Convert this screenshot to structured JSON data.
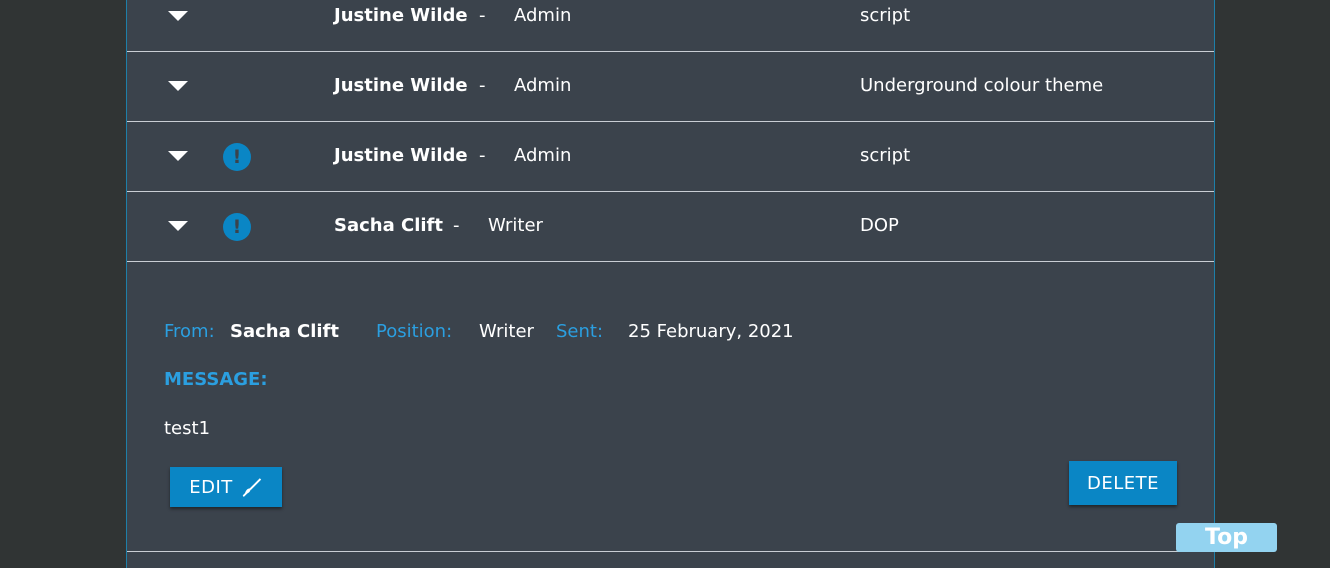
{
  "messages": [
    {
      "name": "Justine Wilde",
      "separator": "-",
      "role": "Admin",
      "subject": "script",
      "alert": false,
      "alert_glyph": "!"
    },
    {
      "name": "Justine Wilde",
      "separator": "-",
      "role": "Admin",
      "subject": "Underground colour theme",
      "alert": false,
      "alert_glyph": "!"
    },
    {
      "name": "Justine Wilde",
      "separator": "-",
      "role": "Admin",
      "subject": "script",
      "alert": true,
      "alert_glyph": "!"
    },
    {
      "name": "Sacha Clift",
      "separator": "-",
      "role": "Writer",
      "subject": "DOP",
      "alert": true,
      "alert_glyph": "!"
    }
  ],
  "detail": {
    "from_label": "From:",
    "from_value": "Sacha Clift",
    "position_label": "Position:",
    "position_value": "Writer",
    "sent_label": "Sent:",
    "sent_value": "25 February, 2021",
    "message_label": "MESSAGE:",
    "message_body": "test1",
    "edit_label": "EDIT",
    "delete_label": "DELETE"
  },
  "top_button": "Top",
  "icons": {
    "row_toggle": "caret-down-icon",
    "alert": "exclamation-circle-icon",
    "edit": "pen-icon"
  },
  "colors": {
    "accent": "#0a86c5",
    "label_blue": "#2b9fe0",
    "panel": "#3b434c",
    "background": "#303434",
    "top_button": "#93d3f0"
  }
}
